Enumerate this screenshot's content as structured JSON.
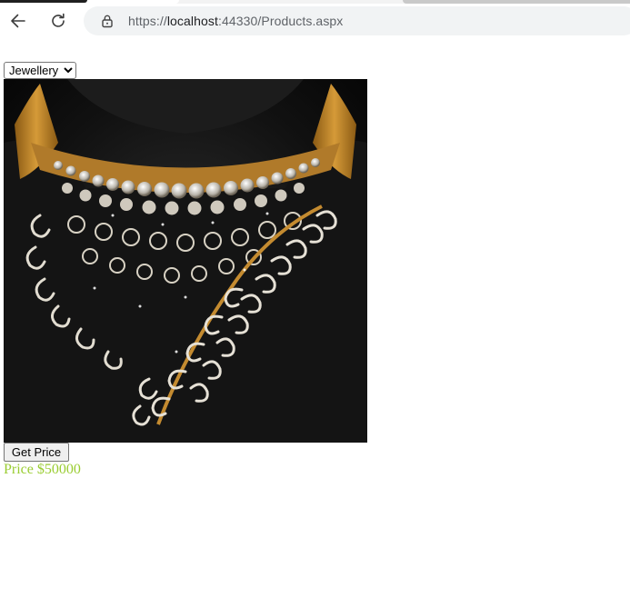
{
  "browser": {
    "url": {
      "scheme": "https://",
      "host": "localhost",
      "rest": ":44330/Products.aspx"
    }
  },
  "page": {
    "category_select": {
      "selected": "Jewellery",
      "options": [
        "Jewellery"
      ]
    },
    "product_image": {
      "alt": "Jewellery"
    },
    "get_price_button": {
      "label": "Get Price"
    },
    "price_label": {
      "text": "Price $50000",
      "color": "#9acd32"
    }
  },
  "colors": {
    "address_bar_bg": "#f1f3f4",
    "button_bg": "#efefef"
  }
}
